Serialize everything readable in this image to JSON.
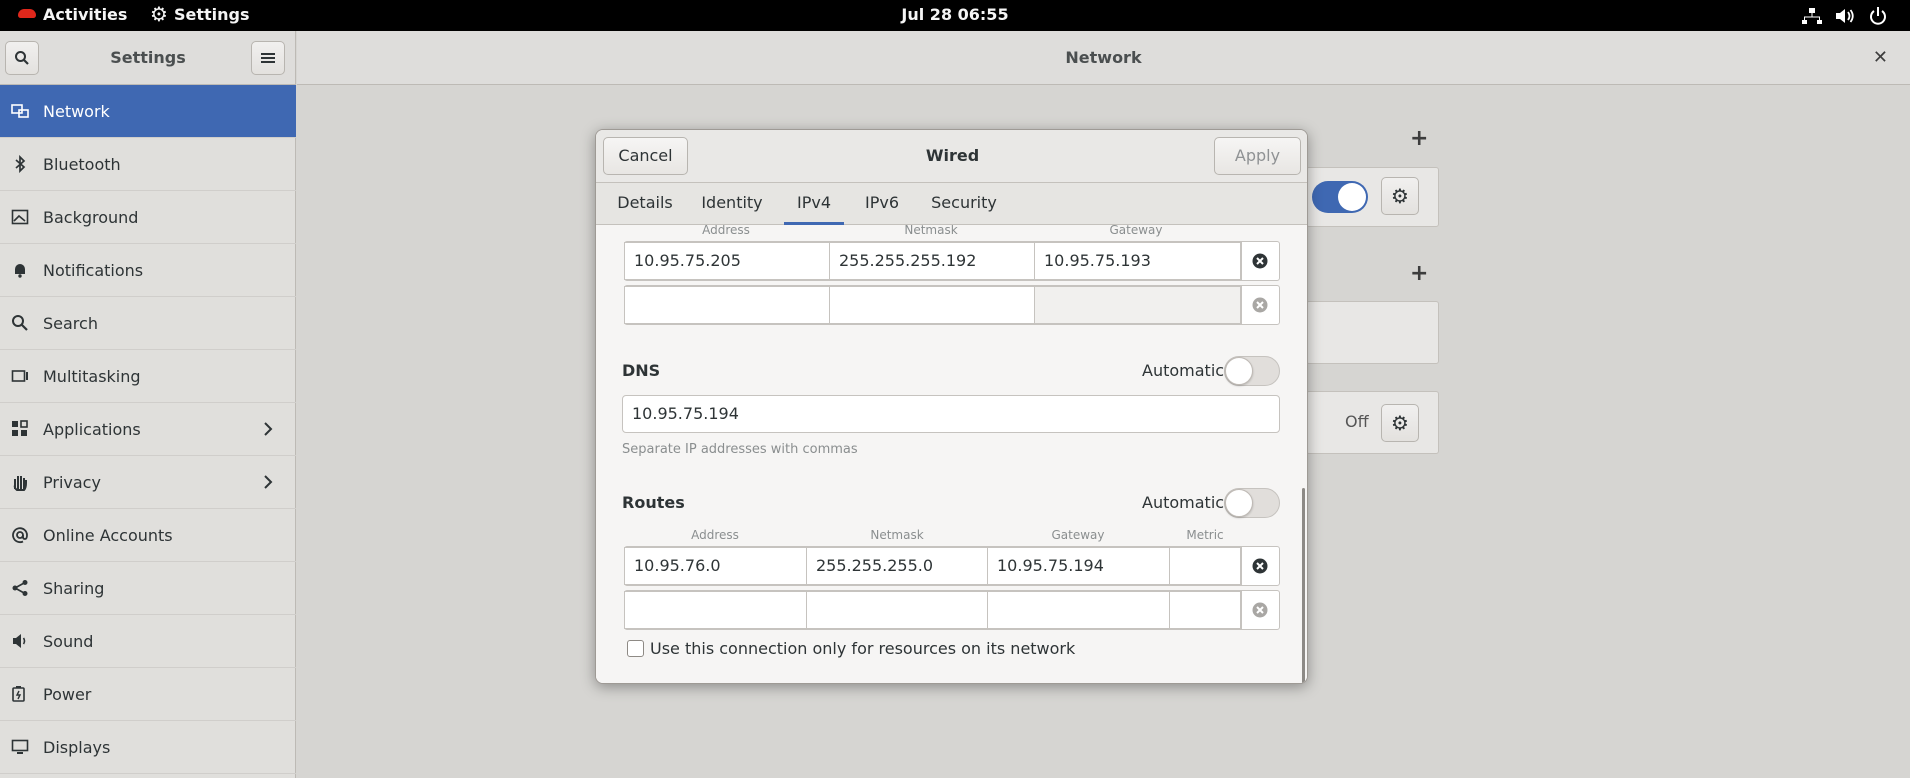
{
  "topbar": {
    "activities": "Activities",
    "app_menu": "Settings",
    "clock": "Jul 28  06:55"
  },
  "sidebar_header": {
    "title": "Settings"
  },
  "main_header": {
    "title": "Network"
  },
  "sidebar": {
    "items": [
      {
        "label": "Network",
        "icon": "network-icon",
        "active": true
      },
      {
        "label": "Bluetooth",
        "icon": "bluetooth-icon"
      },
      {
        "label": "Background",
        "icon": "background-icon"
      },
      {
        "label": "Notifications",
        "icon": "bell-icon"
      },
      {
        "label": "Search",
        "icon": "search-icon"
      },
      {
        "label": "Multitasking",
        "icon": "multitasking-icon"
      },
      {
        "label": "Applications",
        "icon": "applications-icon",
        "has_submenu": true
      },
      {
        "label": "Privacy",
        "icon": "hand-icon",
        "has_submenu": true
      },
      {
        "label": "Online Accounts",
        "icon": "at-icon"
      },
      {
        "label": "Sharing",
        "icon": "share-icon"
      },
      {
        "label": "Sound",
        "icon": "speaker-icon"
      },
      {
        "label": "Power",
        "icon": "battery-icon"
      },
      {
        "label": "Displays",
        "icon": "display-icon"
      }
    ]
  },
  "background_panel": {
    "vpn_status": "Off"
  },
  "dialog": {
    "title": "Wired",
    "cancel_label": "Cancel",
    "apply_label": "Apply",
    "tabs": [
      "Details",
      "Identity",
      "IPv4",
      "IPv6",
      "Security"
    ],
    "active_tab": "IPv4",
    "addresses": {
      "headers": {
        "address": "Address",
        "netmask": "Netmask",
        "gateway": "Gateway"
      },
      "rows": [
        {
          "address": "10.95.75.205",
          "netmask": "255.255.255.192",
          "gateway": "10.95.75.193"
        },
        {
          "address": "",
          "netmask": "",
          "gateway": ""
        }
      ]
    },
    "dns": {
      "title": "DNS",
      "automatic_label": "Automatic",
      "automatic": false,
      "value": "10.95.75.194",
      "hint": "Separate IP addresses with commas"
    },
    "routes": {
      "title": "Routes",
      "automatic_label": "Automatic",
      "automatic": false,
      "headers": {
        "address": "Address",
        "netmask": "Netmask",
        "gateway": "Gateway",
        "metric": "Metric"
      },
      "rows": [
        {
          "address": "10.95.76.0",
          "netmask": "255.255.255.0",
          "gateway": "10.95.75.194",
          "metric": ""
        },
        {
          "address": "",
          "netmask": "",
          "gateway": "",
          "metric": ""
        }
      ]
    },
    "only_local_label": "Use this connection only for resources on its network",
    "only_local_checked": false
  },
  "colors": {
    "accent": "#3f68b2",
    "topbar_bg": "#000000",
    "sidebar_bg": "#e0dfdc"
  }
}
